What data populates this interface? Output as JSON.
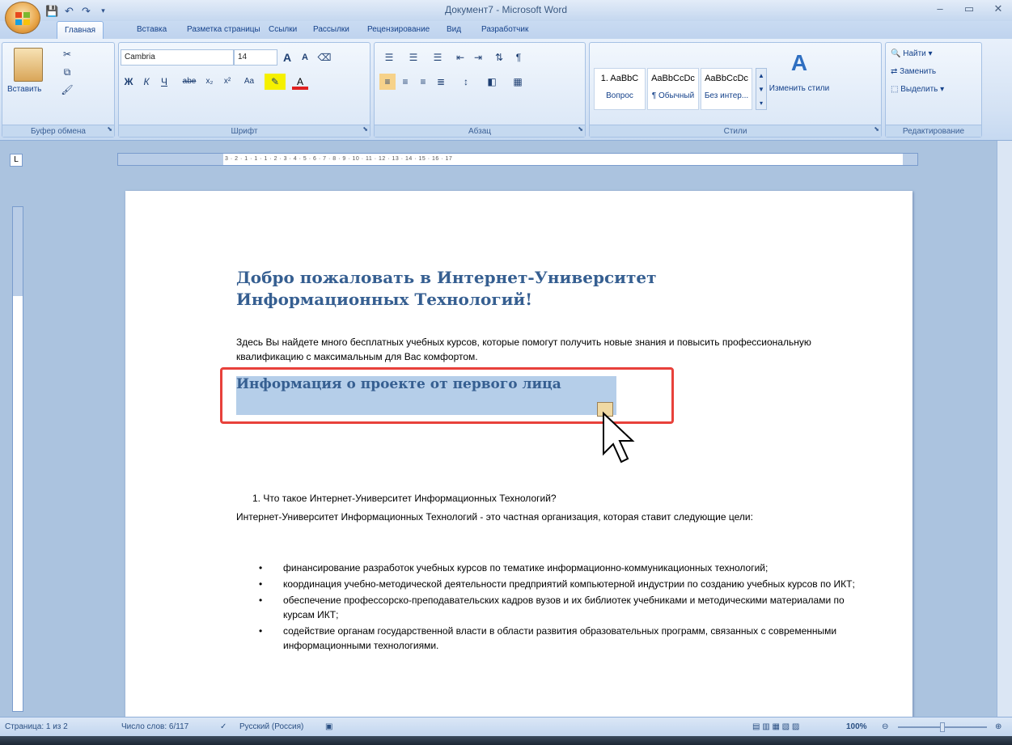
{
  "window": {
    "title": "Документ7 - Microsoft Word",
    "minimize": "–",
    "maximize": "▭",
    "close": "✕"
  },
  "quick_access": {
    "save_icon": "save-icon",
    "undo_icon": "undo-icon",
    "redo_icon": "redo-icon"
  },
  "tabs": [
    {
      "label": "Главная",
      "active": true
    },
    {
      "label": "Вставка"
    },
    {
      "label": "Разметка страницы"
    },
    {
      "label": "Ссылки"
    },
    {
      "label": "Рассылки"
    },
    {
      "label": "Рецензирование"
    },
    {
      "label": "Вид"
    },
    {
      "label": "Разработчик"
    }
  ],
  "ribbon": {
    "clipboard": {
      "label": "Буфер обмена",
      "paste": "Вставить"
    },
    "font": {
      "label": "Шрифт",
      "family": "Cambria",
      "size": "14",
      "grow": "A",
      "shrink": "A",
      "bold": "Ж",
      "italic": "К",
      "underline": "Ч",
      "strike": "abe",
      "subscript": "x₂",
      "superscript": "x²",
      "case": "Aa"
    },
    "paragraph": {
      "label": "Абзац"
    },
    "styles": {
      "label": "Стили",
      "items": [
        {
          "sample": "1. AaBbC",
          "name": "Вопрос"
        },
        {
          "sample": "AaBbCcDc",
          "name": "¶ Обычный"
        },
        {
          "sample": "AaBbCcDc",
          "name": "Без интер..."
        }
      ],
      "change": "Изменить стили"
    },
    "editing": {
      "label": "Редактирование",
      "find": "Найти",
      "replace": "Заменить",
      "select": "Выделить"
    }
  },
  "ruler": {
    "numbers": "3 · 2 · 1 · 1 · 1 · 2 · 3 · 4 · 5 · 6 · 7 · 8 · 9 · 10 · 11 · 12 · 13 · 14 · 15 · 16 · 17"
  },
  "document": {
    "heading1": "Добро пожаловать в Интернет-Университет Информационных Технологий!",
    "intro": "Здесь Вы найдете много бесплатных учебных курсов, которые помогут получить новые знания и повысить профессиональную квалификацию с максимальным для Вас комфортом.",
    "heading2": "Информация о проекте от первого лица",
    "numbered_item": "1.   Что такое Интернет-Университет Информационных Технологий?",
    "org_text": "Интернет-Университет Информационных Технологий - это частная организация, которая ставит следующие цели:",
    "bullets": [
      "финансирование разработок учебных курсов по тематике информационно-коммуникационных технологий;",
      "координация учебно-методической деятельности предприятий компьютерной индустрии по созданию учебных курсов по ИКТ;",
      "обеспечение профессорско-преподавательских кадров вузов и их библиотек учебниками и методическими материалами по курсам ИКТ;",
      "содействие органам государственной власти в области развития образовательных программ, связанных с современными информационными технологиями."
    ]
  },
  "status": {
    "page": "Страница: 1 из 2",
    "words": "Число слов: 6/117",
    "language": "Русский (Россия)",
    "zoom": "100%"
  },
  "colors": {
    "heading": "#365f91",
    "selection_highlight": "#b5cee9",
    "callout_border": "#e8413b"
  }
}
